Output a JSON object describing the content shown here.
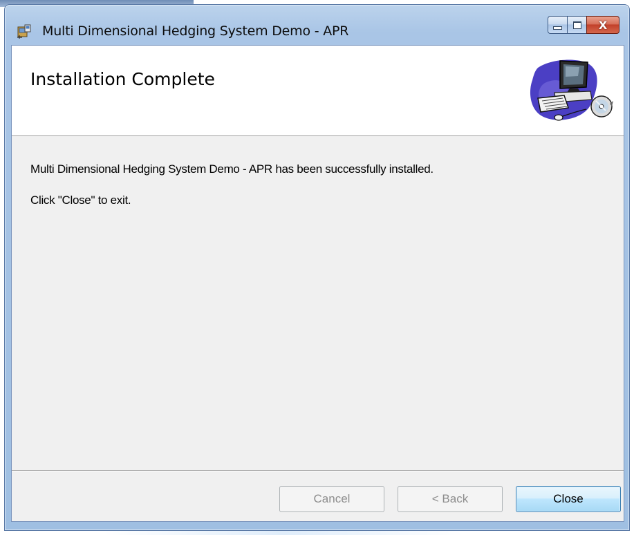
{
  "window": {
    "title": "Multi Dimensional Hedging System Demo - APR",
    "icon": "installer-icon",
    "caption_buttons": {
      "minimize": "minimize-icon",
      "maximize": "maximize-icon",
      "close_glyph": "X"
    }
  },
  "header": {
    "title": "Installation Complete",
    "graphic": "computer-cd-icon"
  },
  "body": {
    "message": "Multi Dimensional Hedging System Demo - APR has been successfully installed.",
    "instruction": "Click \"Close\" to exit."
  },
  "buttons": {
    "cancel": "Cancel",
    "back": "< Back",
    "close": "Close"
  }
}
